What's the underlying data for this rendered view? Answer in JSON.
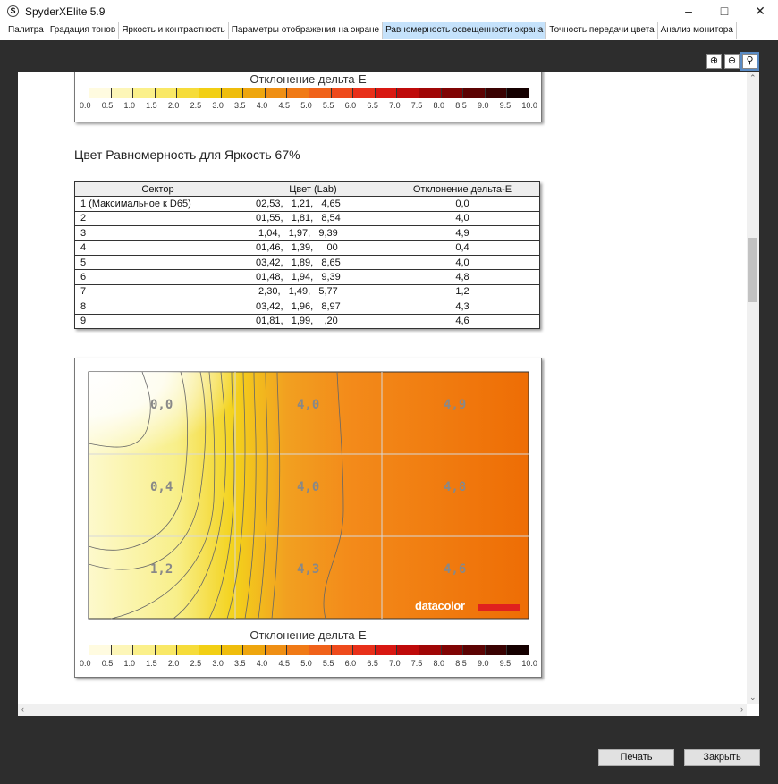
{
  "window": {
    "title": "SpyderXElite 5.9",
    "icon": "S"
  },
  "tabs": [
    {
      "label": "Палитра"
    },
    {
      "label": "Градация тонов"
    },
    {
      "label": "Яркость и контрастность"
    },
    {
      "label": "Параметры отображения на экране"
    },
    {
      "label": "Равномерность освещенности экрана",
      "active": true
    },
    {
      "label": "Точность передачи цвета"
    },
    {
      "label": "Анализ монитора"
    }
  ],
  "zoom_buttons": [
    "zoom-in-icon",
    "zoom-out-icon",
    "zoom-fit-icon"
  ],
  "colorbar": {
    "title": "Отклонение дельта-E",
    "ticks": [
      "0.0",
      "0.5",
      "1.0",
      "1.5",
      "2.0",
      "2.5",
      "3.0",
      "3.5",
      "4.0",
      "4.5",
      "5.0",
      "5.5",
      "6.0",
      "6.5",
      "7.0",
      "7.5",
      "8.0",
      "8.5",
      "9.0",
      "9.5",
      "10.0"
    ],
    "colors": [
      "#fffbe0",
      "#fdf6b8",
      "#fbf08a",
      "#f9e866",
      "#f6dc3a",
      "#f2cf14",
      "#efbd0c",
      "#eea60e",
      "#ef8f14",
      "#f07a16",
      "#f0621a",
      "#ee4a1c",
      "#e8301a",
      "#d81812",
      "#bf0a0a",
      "#a00606",
      "#800404",
      "#5c0303",
      "#3a0202",
      "#150000"
    ]
  },
  "section": {
    "heading": "Цвет Равномерность для Яркость 67%"
  },
  "table": {
    "headers": [
      "Сектор",
      "Цвет (Lab)",
      "Отклонение дельта-E"
    ],
    "rows": [
      [
        "1 (Максимальное к D65)",
        "02,53,   1,21,   4,65",
        "0,0"
      ],
      [
        "2",
        "01,55,   1,81,   8,54",
        "4,0"
      ],
      [
        "3",
        " 1,04,   1,97,   9,39",
        "4,9"
      ],
      [
        "4",
        "01,46,   1,39,     00",
        "0,4"
      ],
      [
        "5",
        "03,42,   1,89,   8,65",
        "4,0"
      ],
      [
        "6",
        "01,48,   1,94,   9,39",
        "4,8"
      ],
      [
        "7",
        " 2,30,   1,49,   5,77",
        "1,2"
      ],
      [
        "8",
        "03,42,   1,96,   8,97",
        "4,3"
      ],
      [
        "9",
        "01,81,   1,99,    ,20",
        "4,6"
      ]
    ]
  },
  "map": {
    "labels": [
      "0,0",
      "4,0",
      "4,9",
      "0,4",
      "4,0",
      "4,8",
      "1,2",
      "4,3",
      "4,6"
    ],
    "logo": "datacolor"
  },
  "buttons": {
    "print": "Печать",
    "close": "Закрыть"
  }
}
